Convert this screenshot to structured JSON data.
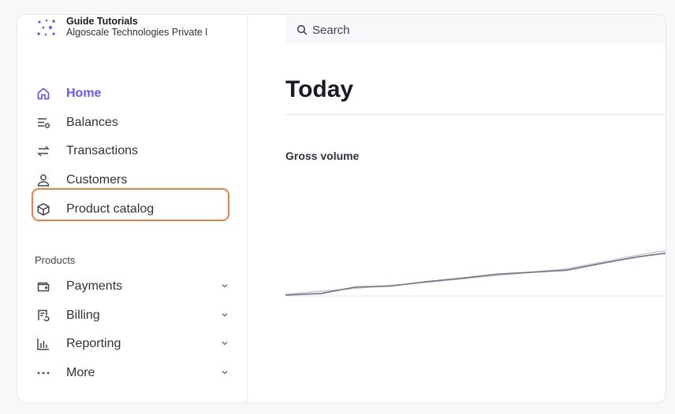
{
  "account": {
    "name": "Guide Tutorials",
    "org": "Algoscale Technologies Private l"
  },
  "nav": {
    "items": [
      {
        "label": "Home",
        "icon": "home-icon",
        "active": true
      },
      {
        "label": "Balances",
        "icon": "balances-icon"
      },
      {
        "label": "Transactions",
        "icon": "transactions-icon"
      },
      {
        "label": "Customers",
        "icon": "customers-icon"
      },
      {
        "label": "Product catalog",
        "icon": "cube-icon",
        "highlighted": true
      }
    ]
  },
  "products": {
    "section_label": "Products",
    "items": [
      {
        "label": "Payments",
        "icon": "wallet-icon"
      },
      {
        "label": "Billing",
        "icon": "billing-icon"
      },
      {
        "label": "Reporting",
        "icon": "bar-chart-icon"
      },
      {
        "label": "More",
        "icon": "more-icon"
      }
    ]
  },
  "search": {
    "placeholder": "Search"
  },
  "page": {
    "title": "Today",
    "metric_label": "Gross volume"
  },
  "colors": {
    "accent": "#635bff",
    "highlight": "#f07f47",
    "line_primary": "#6b7385",
    "line_secondary": "#c7ccd3"
  },
  "chart_data": {
    "type": "line",
    "title": "Gross volume",
    "xlabel": "",
    "ylabel": "",
    "grid": false,
    "x": [
      0,
      1,
      2,
      3,
      4,
      5,
      6,
      7,
      8,
      9,
      10,
      11
    ],
    "series": [
      {
        "values": [
          0.0,
          0.5,
          2.4,
          2.7,
          4.0,
          5.0,
          6.2,
          6.8,
          7.4,
          9.4,
          11.3,
          12.7
        ]
      },
      {
        "values": [
          0.2,
          1.2,
          2.0,
          2.9,
          3.8,
          4.8,
          5.8,
          6.8,
          7.8,
          9.8,
          11.8,
          13.5
        ]
      }
    ],
    "ylim": [
      0,
      14
    ]
  }
}
